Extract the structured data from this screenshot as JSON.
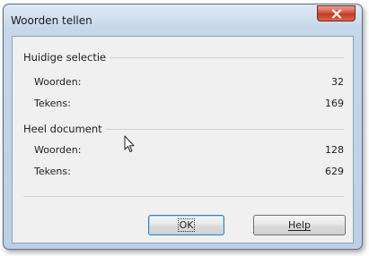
{
  "window": {
    "title": "Woorden tellen"
  },
  "current_selection": {
    "heading": "Huidige selectie",
    "words_label": "Woorden:",
    "words_value": "32",
    "chars_label": "Tekens:",
    "chars_value": "169"
  },
  "whole_document": {
    "heading": "Heel document",
    "words_label": "Woorden:",
    "words_value": "128",
    "chars_label": "Tekens:",
    "chars_value": "629"
  },
  "buttons": {
    "ok_label": "OK",
    "help_label": "Help"
  },
  "colors": {
    "frame": "#bccfe6",
    "close": "#c33a24",
    "dialog_bg": "#f0f0f0",
    "default_button_border": "#3c7fb1"
  },
  "icons": {
    "close": "close-icon",
    "pointer": "mouse-pointer-icon"
  }
}
